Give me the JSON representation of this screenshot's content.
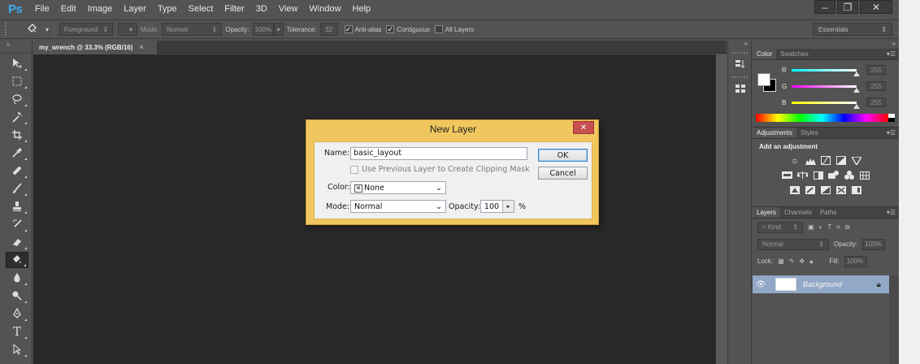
{
  "menubar": {
    "logo": "Ps",
    "items": [
      "File",
      "Edit",
      "Image",
      "Layer",
      "Type",
      "Select",
      "Filter",
      "3D",
      "View",
      "Window",
      "Help"
    ],
    "window_buttons": [
      "–",
      "❐",
      "✕"
    ]
  },
  "options": {
    "fill_source": "Foreground",
    "mode_label": "Mode:",
    "mode_value": "Normal",
    "opacity_label": "Opacity:",
    "opacity_value": "100%",
    "tolerance_label": "Tolerance:",
    "tolerance_value": "32",
    "antialias_label": "Anti-alias",
    "antialias_checked": true,
    "contiguous_label": "Contiguous",
    "contiguous_checked": true,
    "all_layers_label": "All Layers",
    "all_layers_checked": false,
    "workspace": "Essentials"
  },
  "document": {
    "tab_title": "my_wrench @ 33.3% (RGB/16)",
    "tab_close": "×"
  },
  "toolbar": {
    "tools": [
      "move-tool",
      "marquee-tool",
      "lasso-tool",
      "magic-wand-tool",
      "crop-tool",
      "eyedropper-tool",
      "healing-brush-tool",
      "brush-tool",
      "clone-stamp-tool",
      "history-brush-tool",
      "eraser-tool",
      "paint-bucket-tool",
      "blur-tool",
      "dodge-tool",
      "pen-tool",
      "type-tool",
      "path-selection-tool",
      "rectangle-tool"
    ],
    "active_tool": "paint-bucket-tool"
  },
  "color_panel": {
    "tabs": [
      "Color",
      "Swatches"
    ],
    "active_tab": "Color",
    "channels": [
      {
        "label": "R",
        "value": "255",
        "color": "#00ffff"
      },
      {
        "label": "G",
        "value": "255",
        "color": "#ff00ff"
      },
      {
        "label": "B",
        "value": "255",
        "color": "#ffff00"
      }
    ],
    "foreground": "#ffffff",
    "background": "#000000"
  },
  "adjustments_panel": {
    "tabs": [
      "Adjustments",
      "Styles"
    ],
    "active_tab": "Adjustments",
    "title": "Add an adjustment"
  },
  "layers_panel": {
    "tabs": [
      "Layers",
      "Channels",
      "Paths"
    ],
    "active_tab": "Layers",
    "filter_kind": "Kind",
    "blend_mode": "Normal",
    "opacity_label": "Opacity:",
    "opacity_value": "100%",
    "lock_label": "Lock:",
    "fill_label": "Fill:",
    "fill_value": "100%",
    "layers": [
      {
        "name": "Background",
        "selected": true,
        "locked": true
      }
    ]
  },
  "dialog": {
    "title": "New Layer",
    "name_label": "Name:",
    "name_value": "basic_layout",
    "clipping_label": "Use Previous Layer to Create Clipping Mask",
    "clipping_checked": false,
    "color_label": "Color:",
    "color_value": "None",
    "mode_label": "Mode:",
    "mode_value": "Normal",
    "opacity_label": "Opacity:",
    "opacity_value": "100",
    "opacity_unit": "%",
    "ok_label": "OK",
    "cancel_label": "Cancel",
    "accent_color": "#f0c75e"
  }
}
